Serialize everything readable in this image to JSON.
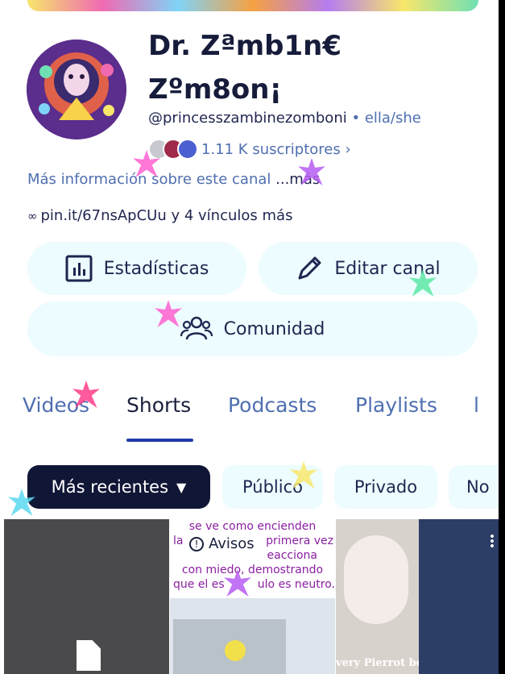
{
  "profile": {
    "channel_name": "Dr. Zªmb1n€ Zºm8on¡",
    "handle": "@princesszambinezomboni",
    "pronouns": "ella/she",
    "subscribers": "1.11 K suscriptores",
    "more_info": "Más información sobre este canal",
    "more_info_link": "...más",
    "links": "pin.it/67nsApCUu y 4 vínculos más"
  },
  "actions": {
    "stats_label": "Estadísticas",
    "edit_label": "Editar canal",
    "community_label": "Comunidad"
  },
  "tabs": [
    {
      "label": "Videos"
    },
    {
      "label": "Shorts"
    },
    {
      "label": "Podcasts"
    },
    {
      "label": "Playlists"
    }
  ],
  "active_tab": "Shorts",
  "filters": [
    {
      "label": "Más recientes"
    },
    {
      "label": "Público"
    },
    {
      "label": "Privado"
    },
    {
      "label": "No"
    }
  ],
  "thumbnails": {
    "t2_lines": [
      "se ve como encienden",
      "la",
      "primera vez",
      "eacciona",
      "con miedo, demostrando",
      "que el es",
      "ulo es neutro."
    ],
    "t2_badge": "Avisos",
    "t3_caption": "very Pierrot boy needs hi"
  },
  "colors": {
    "accent": "#1f3aa8",
    "chip_selected_bg": "#101635",
    "pill_bg": "#edfcfe",
    "secondary_text": "#4f6fb0"
  }
}
